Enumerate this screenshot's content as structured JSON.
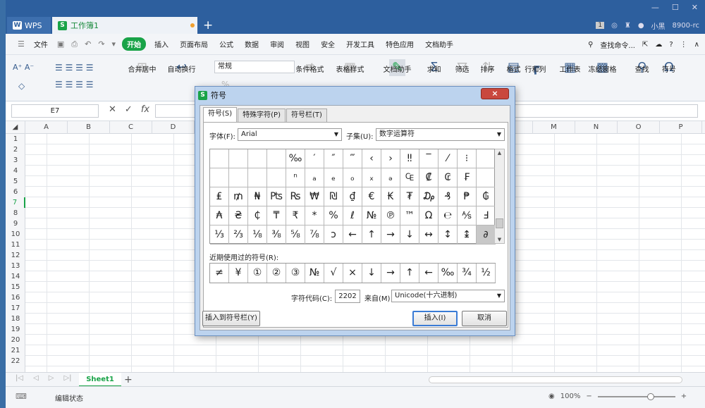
{
  "app": {
    "wps_tab": "WPS",
    "doc_tab": "工作簿1",
    "badge": "1",
    "user": "小黑",
    "version": "8900-rc"
  },
  "menu": {
    "file": "文件",
    "start": "开始",
    "items": [
      "插入",
      "页面布局",
      "公式",
      "数据",
      "审阅",
      "视图",
      "安全",
      "开发工具",
      "特色应用",
      "文档助手"
    ],
    "search": "查找命令..."
  },
  "ribbon": {
    "font_a": "A⁺ A⁻",
    "merge": "合并居中",
    "wrap": "自动换行",
    "format_value": "常规",
    "percent": "% ,",
    "cond_format": "条件格式",
    "table_style": "表格样式",
    "doc_helper": "文档助手",
    "sum": "求和",
    "filter": "筛选",
    "sort": "排序",
    "format": "格式",
    "row_col": "行和列",
    "worksheet": "工作表",
    "freeze": "冻结窗格",
    "find": "查找",
    "symbol": "符号"
  },
  "formula_bar": {
    "name_box": "E7",
    "fx": "fx"
  },
  "grid": {
    "columns": [
      "A",
      "B",
      "C",
      "D",
      "E",
      "F",
      "G",
      "H",
      "I",
      "J",
      "K",
      "L",
      "M",
      "N",
      "O",
      "P"
    ],
    "rows": [
      "1",
      "2",
      "3",
      "4",
      "5",
      "6",
      "7",
      "8",
      "9",
      "10",
      "11",
      "12",
      "13",
      "14",
      "15",
      "16",
      "17",
      "18",
      "19",
      "20",
      "21",
      "22"
    ],
    "active_row": "7"
  },
  "sheets": {
    "active": "Sheet1",
    "add": "+"
  },
  "status": {
    "text": "编辑状态",
    "zoom": "100%"
  },
  "dialog": {
    "title": "符号",
    "close": "×",
    "tabs": [
      "符号(S)",
      "特殊字符(P)",
      "符号栏(T)"
    ],
    "font_label": "字体(F):",
    "font_value": "Arial",
    "subset_label": "子集(U):",
    "subset_value": "数字运算符",
    "symbols": [
      "",
      "",
      "",
      "",
      "‰",
      "′",
      "″",
      "‴",
      "‹",
      "›",
      "‼",
      "‾",
      "⁄",
      "⁝",
      "",
      "",
      "",
      "",
      "",
      "ⁿ",
      "ₐ",
      "ₑ",
      "ₒ",
      "ₓ",
      "ₔ",
      "₠",
      "₡",
      "₢",
      "₣",
      "",
      "₤",
      "₥",
      "₦",
      "₧",
      "₨",
      "₩",
      "₪",
      "₫",
      "€",
      "₭",
      "₮",
      "₯",
      "₰",
      "₱",
      "₲",
      "₳",
      "₴",
      "₵",
      "₸",
      "₹",
      "*",
      "%",
      "ℓ",
      "№",
      "℗",
      "™",
      "Ω",
      "℮",
      "⅍",
      "Ⅎ",
      "⅓",
      "⅔",
      "⅛",
      "⅜",
      "⅝",
      "⅞",
      "ↄ",
      "←",
      "↑",
      "→",
      "↓",
      "↔",
      "↕",
      "↨",
      "∂"
    ],
    "selected_symbol": "∂",
    "recent_label": "近期使用过的符号(R):",
    "recent": [
      "≠",
      "¥",
      "①",
      "②",
      "③",
      "№",
      "√",
      "×",
      "↓",
      "→",
      "↑",
      "←",
      "‰",
      "¾",
      "½"
    ],
    "code_label": "字符代码(C):",
    "code_value": "2202",
    "from_label": "来自(M)",
    "from_value": "Unicode(十六进制)",
    "insert_bar": "插入到符号栏(Y)",
    "insert": "插入(I)",
    "cancel": "取消"
  }
}
